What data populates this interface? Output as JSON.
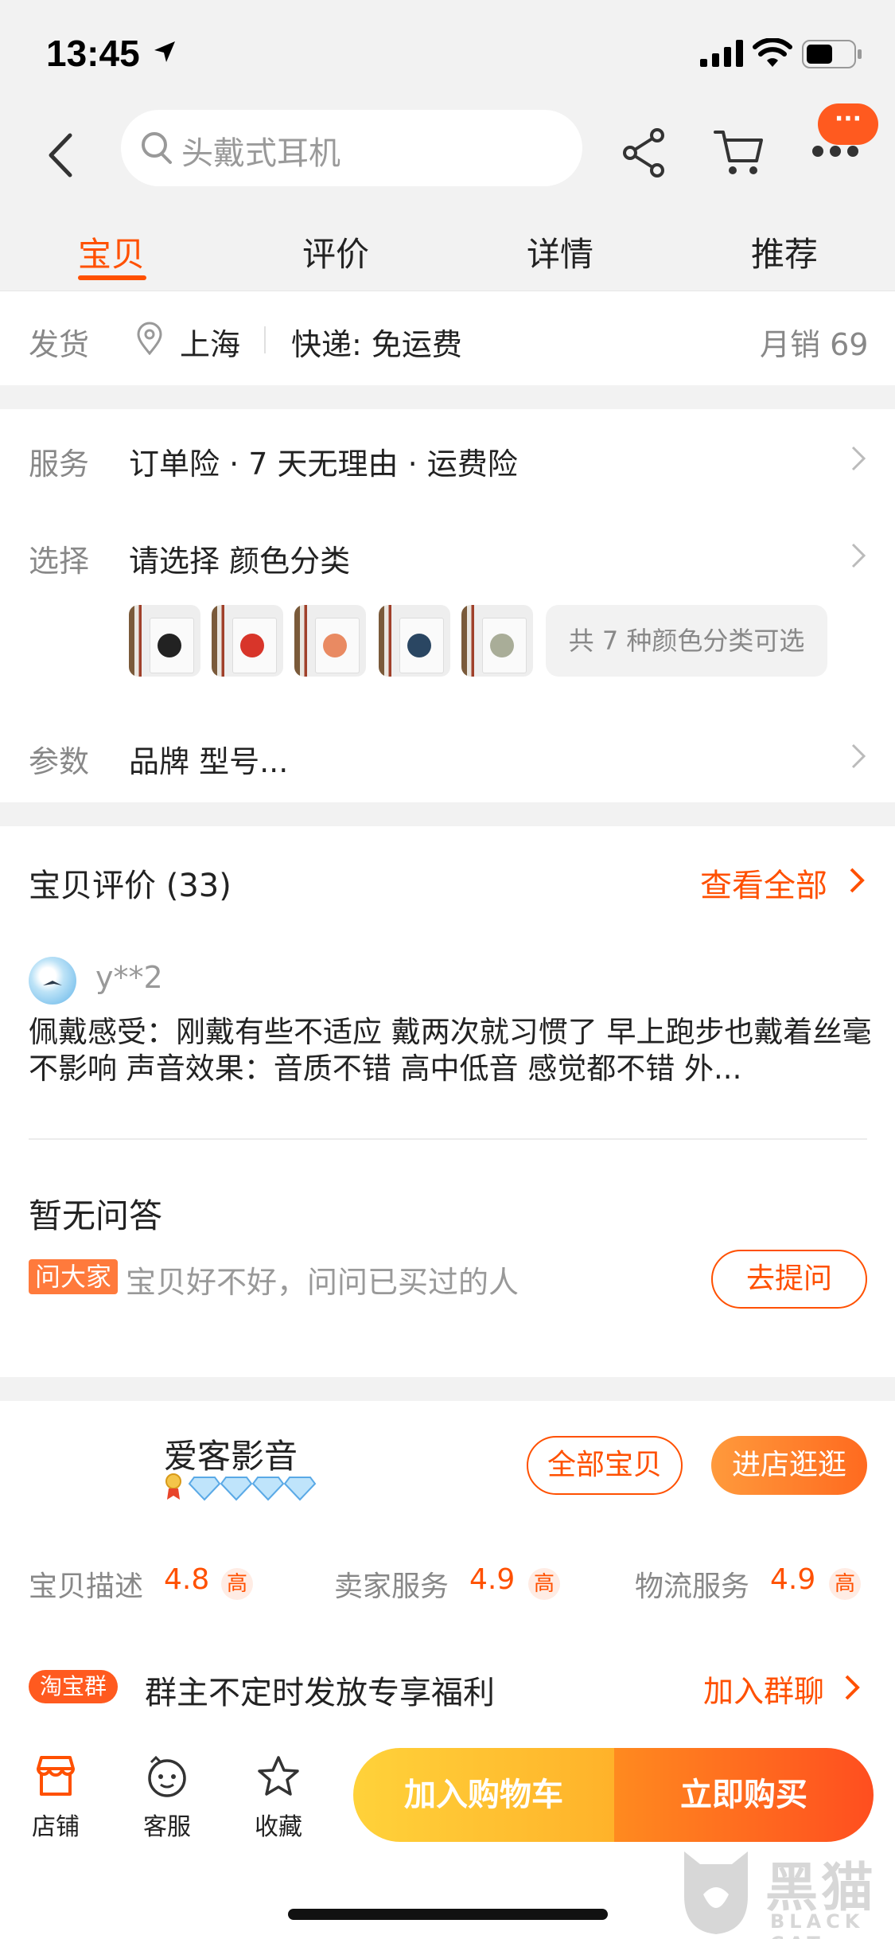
{
  "status_bar": {
    "time": "13:45"
  },
  "search": {
    "placeholder": "头戴式耳机"
  },
  "message_badge": "···",
  "tabs": [
    {
      "label": "宝贝",
      "active": true
    },
    {
      "label": "评价",
      "active": false
    },
    {
      "label": "详情",
      "active": false
    },
    {
      "label": "推荐",
      "active": false
    }
  ],
  "shipping": {
    "label": "发货",
    "city": "上海",
    "express": "快递: 免运费",
    "monthly_sales": "月销 69"
  },
  "options": {
    "service_label": "服务",
    "service_value": "订单险 · 7 天无理由 · 运费险",
    "select_label": "选择",
    "select_value": "请选择 颜色分类",
    "color_thumbs": [
      "black",
      "red",
      "peach",
      "navy",
      "sage"
    ],
    "more_colors": "共 7 种颜色分类可选",
    "param_label": "参数",
    "param_value": "品牌 型号..."
  },
  "reviews": {
    "title": "宝贝评价 (33)",
    "view_all": "查看全部",
    "reviewer": "y**2",
    "text": "佩戴感受：刚戴有些不适应 戴两次就习惯了 早上跑步也戴着丝毫不影响 声音效果：音质不错 高中低音 感觉都不错 外..."
  },
  "qa": {
    "title": "暂无问答",
    "ask_tag": "问大家",
    "hint": "宝贝好不好，问问已买过的人",
    "ask_button": "去提问"
  },
  "shop": {
    "name": "爱客影音",
    "all_items_button": "全部宝贝",
    "enter_shop_button": "进店逛逛",
    "scores": [
      {
        "label": "宝贝描述",
        "value": "4.8",
        "tag": "高"
      },
      {
        "label": "卖家服务",
        "value": "4.9",
        "tag": "高"
      },
      {
        "label": "物流服务",
        "value": "4.9",
        "tag": "高"
      }
    ],
    "group_tag": "淘宝群",
    "group_text": "群主不定时发放专享福利",
    "group_join": "加入群聊"
  },
  "bottom_bar": {
    "store": "店铺",
    "service": "客服",
    "favorite": "收藏",
    "add_to_cart": "加入购物车",
    "buy_now": "立即购买"
  },
  "watermark": {
    "cn": "黑猫",
    "en": "BLACK CAT"
  },
  "colors": {
    "accent": "#ff5000",
    "cart_yellow": "#ffc22a",
    "buy_orange": "#ff5a1f"
  }
}
